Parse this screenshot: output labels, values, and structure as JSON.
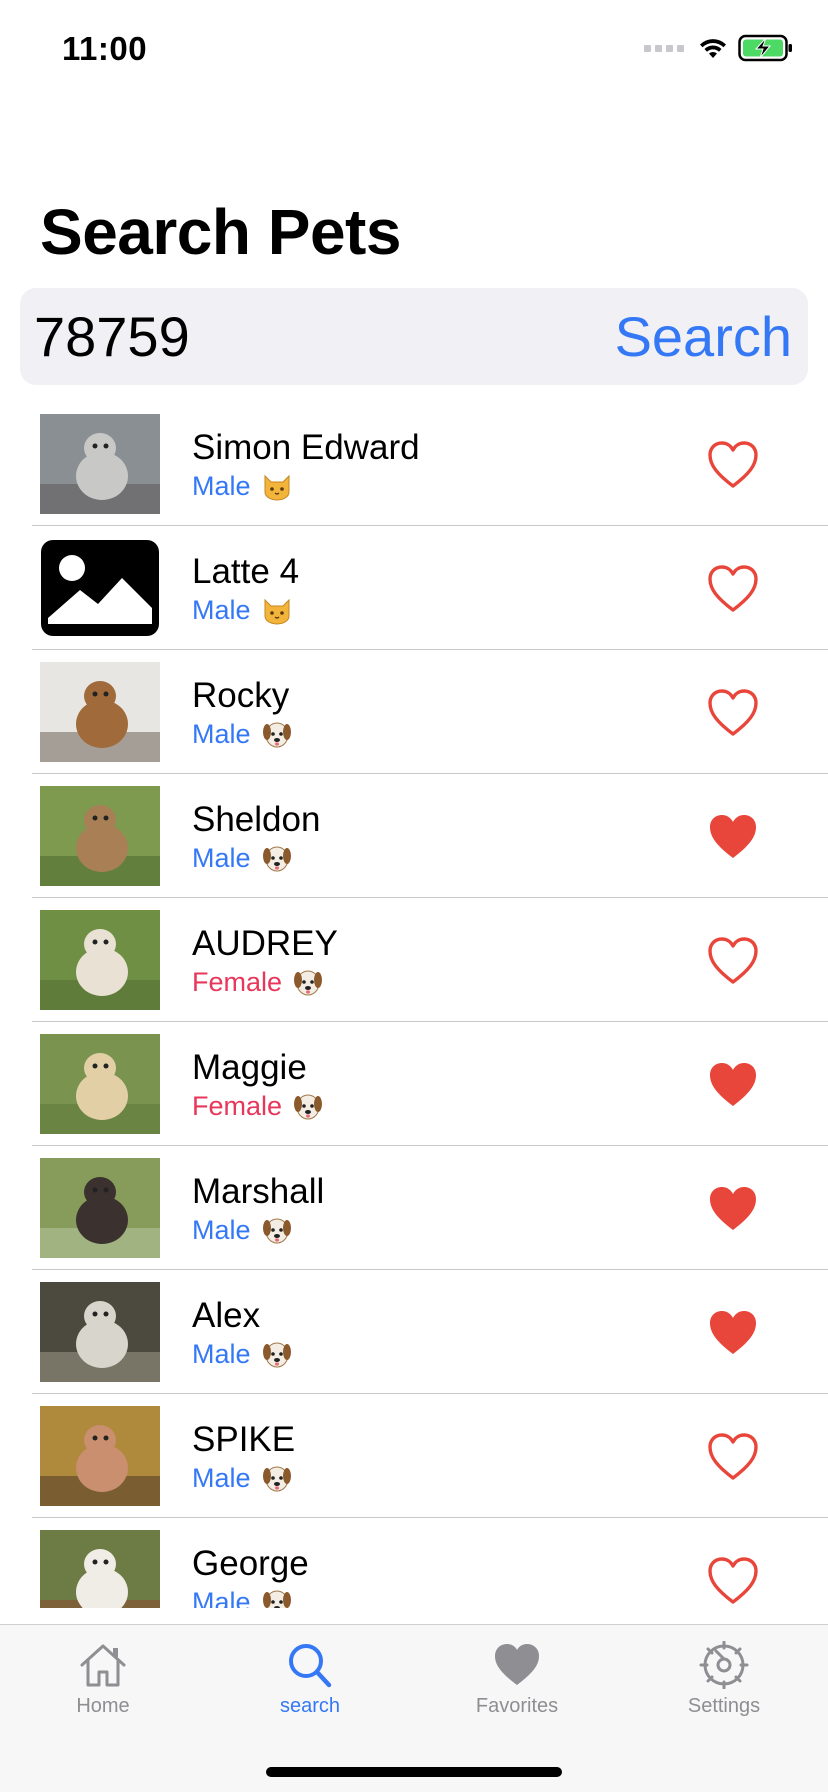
{
  "status_bar": {
    "time": "11:00"
  },
  "page": {
    "title": "Search Pets"
  },
  "search": {
    "value": "78759",
    "button_label": "Search"
  },
  "colors": {
    "accent": "#3478f6",
    "male": "#3478f6",
    "female": "#e8375a",
    "heart": "#e9463b"
  },
  "pets": [
    {
      "name": "Simon Edward",
      "gender": "Male",
      "species": "cat",
      "favorite": false,
      "photo": "cat-photo"
    },
    {
      "name": "Latte 4",
      "gender": "Male",
      "species": "cat",
      "favorite": false,
      "photo": "placeholder-image-icon"
    },
    {
      "name": "Rocky",
      "gender": "Male",
      "species": "dog",
      "favorite": false,
      "photo": "dog-photo"
    },
    {
      "name": "Sheldon",
      "gender": "Male",
      "species": "dog",
      "favorite": true,
      "photo": "dog-photo"
    },
    {
      "name": "AUDREY",
      "gender": "Female",
      "species": "dog",
      "favorite": false,
      "photo": "dog-photo"
    },
    {
      "name": "Maggie",
      "gender": "Female",
      "species": "dog",
      "favorite": true,
      "photo": "dog-photo"
    },
    {
      "name": "Marshall",
      "gender": "Male",
      "species": "dog",
      "favorite": true,
      "photo": "dog-photo"
    },
    {
      "name": "Alex",
      "gender": "Male",
      "species": "dog",
      "favorite": true,
      "photo": "dog-photo"
    },
    {
      "name": "SPIKE",
      "gender": "Male",
      "species": "dog",
      "favorite": false,
      "photo": "dog-photo"
    },
    {
      "name": "George",
      "gender": "Male",
      "species": "dog",
      "favorite": false,
      "photo": "dog-photo"
    }
  ],
  "tabs": [
    {
      "label": "Home",
      "icon": "home-icon",
      "active": false
    },
    {
      "label": "search",
      "icon": "search-icon",
      "active": true
    },
    {
      "label": "Favorites",
      "icon": "heart-icon",
      "active": false
    },
    {
      "label": "Settings",
      "icon": "gear-icon",
      "active": false
    }
  ]
}
